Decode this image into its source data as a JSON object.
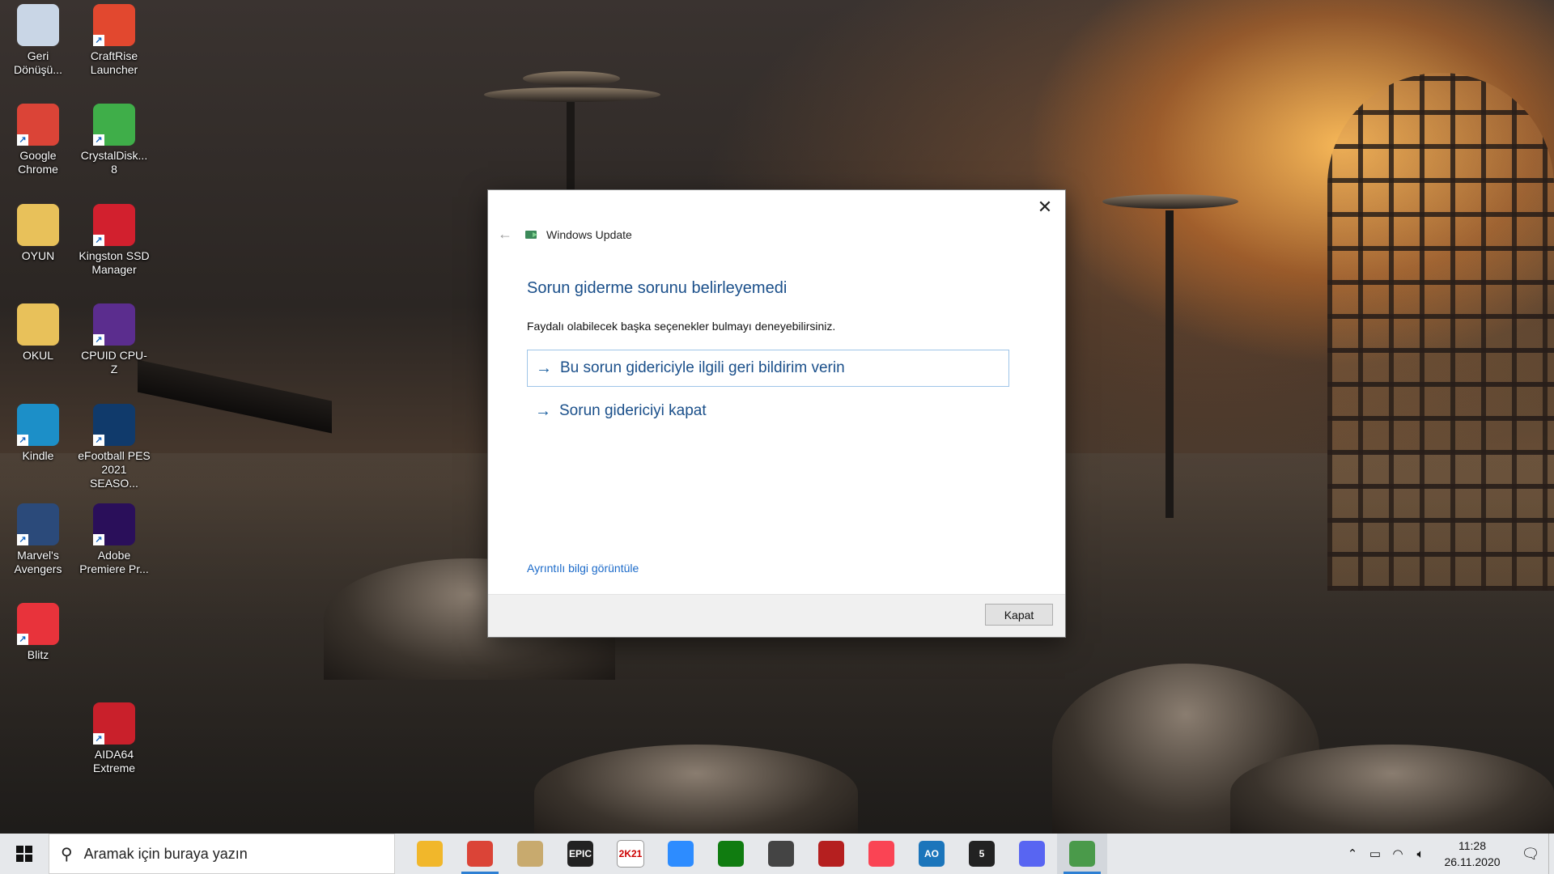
{
  "desktop": {
    "icons": [
      {
        "label": "Geri Dönüşü...",
        "icon": "recycle-bin-icon",
        "color": "#c9d6e6"
      },
      {
        "label": "CraftRise Launcher",
        "icon": "craftrise-icon",
        "color": "#e2482f"
      },
      {
        "label": "Google Chrome",
        "icon": "chrome-icon",
        "color": "#db4437"
      },
      {
        "label": "CrystalDisk... 8",
        "icon": "crystaldisk-icon",
        "color": "#3fae49"
      },
      {
        "label": "OYUN",
        "icon": "folder-icon",
        "color": "#e8c15a"
      },
      {
        "label": "Kingston SSD Manager",
        "icon": "kingston-icon",
        "color": "#d2202e"
      },
      {
        "label": "OKUL",
        "icon": "folder-icon",
        "color": "#e8c15a"
      },
      {
        "label": "CPUID CPU-Z",
        "icon": "cpuz-icon",
        "color": "#5b2d8e"
      },
      {
        "label": "Kindle",
        "icon": "kindle-icon",
        "color": "#1c8fc8"
      },
      {
        "label": "eFootball PES 2021 SEASO...",
        "icon": "pes-icon",
        "color": "#103a6b"
      },
      {
        "label": "Marvel's Avengers",
        "icon": "avengers-icon",
        "color": "#2b4a7a"
      },
      {
        "label": "Adobe Premiere Pr...",
        "icon": "premiere-icon",
        "color": "#2a0f5a"
      },
      {
        "label": "Blitz",
        "icon": "blitz-icon",
        "color": "#e8333b"
      },
      {
        "label": "AIDA64 Extreme",
        "icon": "aida64-icon",
        "color": "#c9202b"
      }
    ]
  },
  "dialog": {
    "window_title": "Windows Update",
    "heading": "Sorun giderme sorunu belirleyemedi",
    "subtitle": "Faydalı olabilecek başka seçenekler bulmayı deneyebilirsiniz.",
    "options": [
      {
        "label": "Bu sorun gidericiyle ilgili geri bildirim verin",
        "focused": true
      },
      {
        "label": "Sorun gidericiyi kapat",
        "focused": false
      }
    ],
    "details_link": "Ayrıntılı bilgi görüntüle",
    "close_button": "Kapat"
  },
  "taskbar": {
    "search_placeholder": "Aramak için buraya yazın",
    "apps": [
      {
        "name": "file-explorer-icon",
        "label": "",
        "color": "#f1b72b"
      },
      {
        "name": "chrome-taskbar-icon",
        "label": "",
        "color": "#db4437"
      },
      {
        "name": "league-of-legends-icon",
        "label": "",
        "color": "#c8aa6e"
      },
      {
        "name": "epic-games-icon",
        "label": "EPIC",
        "color": "#222222"
      },
      {
        "name": "nba2k21-icon",
        "label": "2K21",
        "color": "#ffffff"
      },
      {
        "name": "zoom-icon",
        "label": "",
        "color": "#2d8cff"
      },
      {
        "name": "xbox-icon",
        "label": "",
        "color": "#107c10"
      },
      {
        "name": "game-icon",
        "label": "",
        "color": "#444444"
      },
      {
        "name": "redcard-icon",
        "label": "",
        "color": "#b51f1f"
      },
      {
        "name": "valorant-icon",
        "label": "",
        "color": "#fa4454"
      },
      {
        "name": "ao-tennis-icon",
        "label": "AO",
        "color": "#1b75bb"
      },
      {
        "name": "channel5-icon",
        "label": "5",
        "color": "#222222"
      },
      {
        "name": "discord-icon",
        "label": "",
        "color": "#5865f2"
      },
      {
        "name": "windows-update-taskbar-icon",
        "label": "",
        "color": "#4a9a4a"
      }
    ],
    "clock_time": "11:28",
    "clock_date": "26.11.2020"
  }
}
